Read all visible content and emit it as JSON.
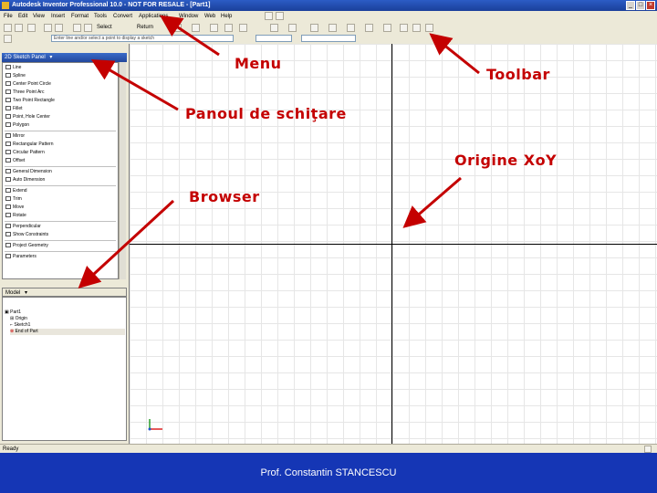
{
  "window": {
    "title": "Autodesk Inventor Professional 10.0 - NOT FOR RESALE - [Part1]",
    "controls": [
      "_",
      "□",
      "×"
    ]
  },
  "menu": {
    "items": [
      "File",
      "Edit",
      "View",
      "Insert",
      "Format",
      "Tools",
      "Convert",
      "Applications",
      "Window",
      "Web",
      "Help"
    ]
  },
  "toolbar": {
    "select_label": "Select",
    "return_label": "Return"
  },
  "command_bar": {
    "hint": "Enter line and/or select a point to display a sketch"
  },
  "sketch_panel": {
    "title": "2D Sketch Panel",
    "items": [
      "Line",
      "Spline",
      "Center Point Circle",
      "Three Point Arc",
      "Two Point Rectangle",
      "Fillet",
      "Point, Hole Center",
      "Polygon",
      "Mirror",
      "Rectangular Pattern",
      "Circular Pattern",
      "Offset",
      "General Dimension",
      "Auto Dimension",
      "Extend",
      "Trim",
      "Move",
      "Rotate",
      "Perpendicular",
      "Show Constraints",
      "Project Geometry",
      "Parameters"
    ]
  },
  "browser": {
    "title": "Model",
    "items": [
      "Part1",
      "Origin",
      "Sketch1",
      "End of Part"
    ]
  },
  "status": {
    "text": "Ready"
  },
  "footer": {
    "author": "Prof. Constantin STANCESCU"
  },
  "annotations": {
    "menu": "Menu",
    "toolbar": "Toolbar",
    "sketch_panel": "Panoul de schiţare",
    "origin": "Origine XoY",
    "browser": "Browser"
  },
  "colors": {
    "annotation": "#c40000",
    "footer_bg": "#1536b5",
    "titlebar": "#2c5cc5"
  }
}
